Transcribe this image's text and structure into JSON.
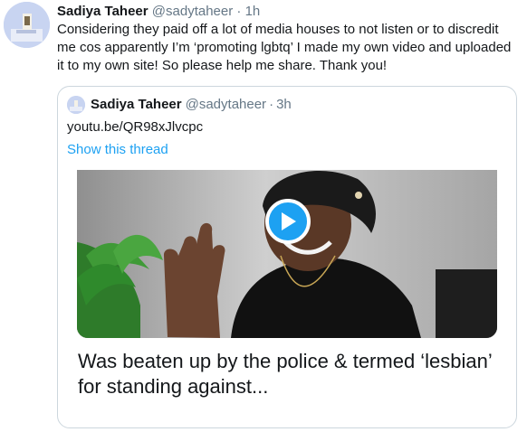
{
  "tweet": {
    "author_name": "Sadiya Taheer",
    "author_handle": "@sadytaheer",
    "separator": "·",
    "time": "1h",
    "text": "Considering they paid off a lot of media houses to not listen or to discredit me cos apparently I’m ‘promoting lgbtq’ I made my own video and uploaded it to my own site! So please help me share. Thank you!"
  },
  "quote": {
    "author_name": "Sadiya Taheer",
    "author_handle": "@sadytaheer",
    "separator": "·",
    "time": "3h",
    "link_text": "youtu.be/QR98xJlvcpc",
    "thread_link": "Show this thread"
  },
  "card": {
    "title": "Was beaten up by the police & termed ‘lesbian’ for standing against...",
    "play_icon": "play-icon"
  },
  "colors": {
    "accent": "#1da1f2",
    "secondary_text": "#657786",
    "border": "#ccd6dd"
  }
}
